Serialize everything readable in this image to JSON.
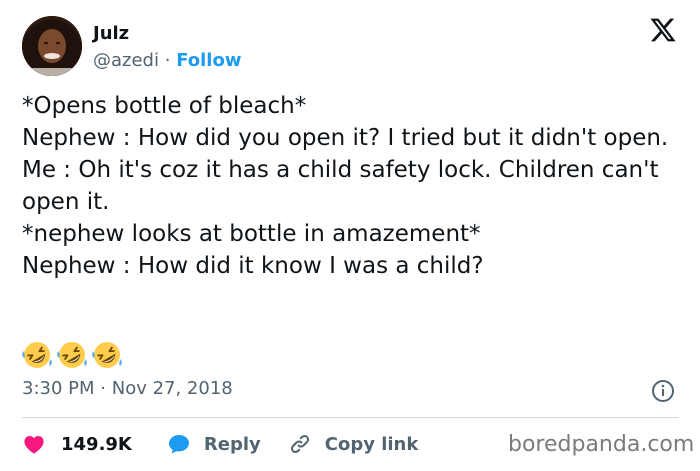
{
  "author": {
    "name": "Julz",
    "handle": "@azedi",
    "separator": "·",
    "follow_label": "Follow"
  },
  "platform_icon": "x-logo-icon",
  "tweet": {
    "lines": [
      "*Opens bottle of bleach*",
      "Nephew : How did you open it? I tried but it didn't open.",
      "Me : Oh it's coz it has a child safety lock. Children can't open it.",
      "*nephew looks at bottle in amazement*",
      "Nephew : How did it know I was a child?"
    ],
    "emoji": [
      "rolling-on-floor-laughing",
      "rolling-on-floor-laughing",
      "rolling-on-floor-laughing"
    ]
  },
  "timestamp": {
    "time": "3:30 PM",
    "separator": "·",
    "date": "Nov 27, 2018"
  },
  "actions": {
    "likes": "149.9K",
    "reply_label": "Reply",
    "copy_label": "Copy link"
  },
  "colors": {
    "accent": "#1d9bf0",
    "heart": "#f91880",
    "text": "#0f1419",
    "muted": "#536471"
  },
  "watermark": "boredpanda.com"
}
